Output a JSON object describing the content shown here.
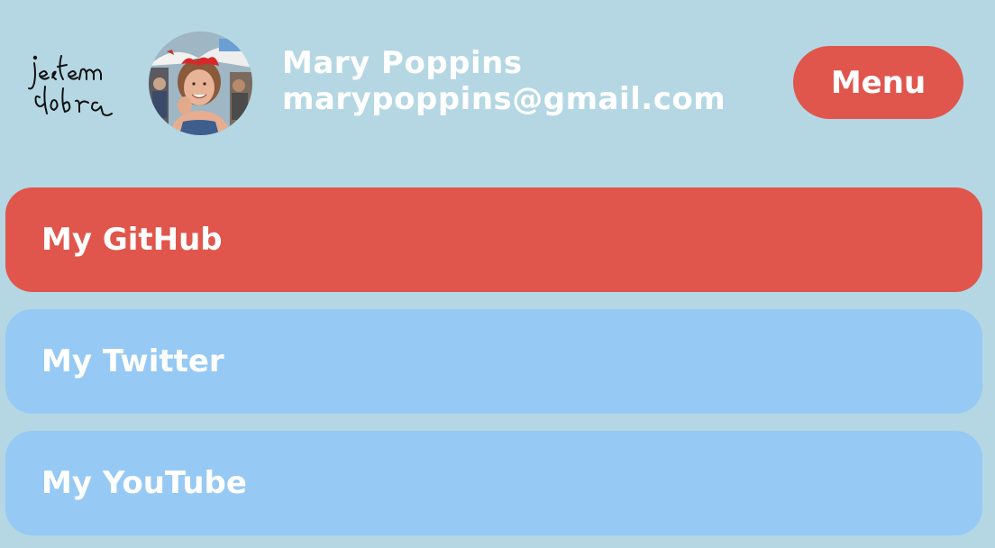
{
  "profile": {
    "name": "Mary Poppins",
    "email": "marypoppins@gmail.com"
  },
  "header": {
    "menu_label": "Menu"
  },
  "links": [
    {
      "label": "My GitHub",
      "state": "active"
    },
    {
      "label": "My Twitter",
      "state": "inactive"
    },
    {
      "label": "My YouTube",
      "state": "inactive"
    }
  ],
  "colors": {
    "background": "#b4d7e3",
    "accent": "#e0564c",
    "link_inactive": "#96c9f3",
    "text": "#ffffff"
  }
}
